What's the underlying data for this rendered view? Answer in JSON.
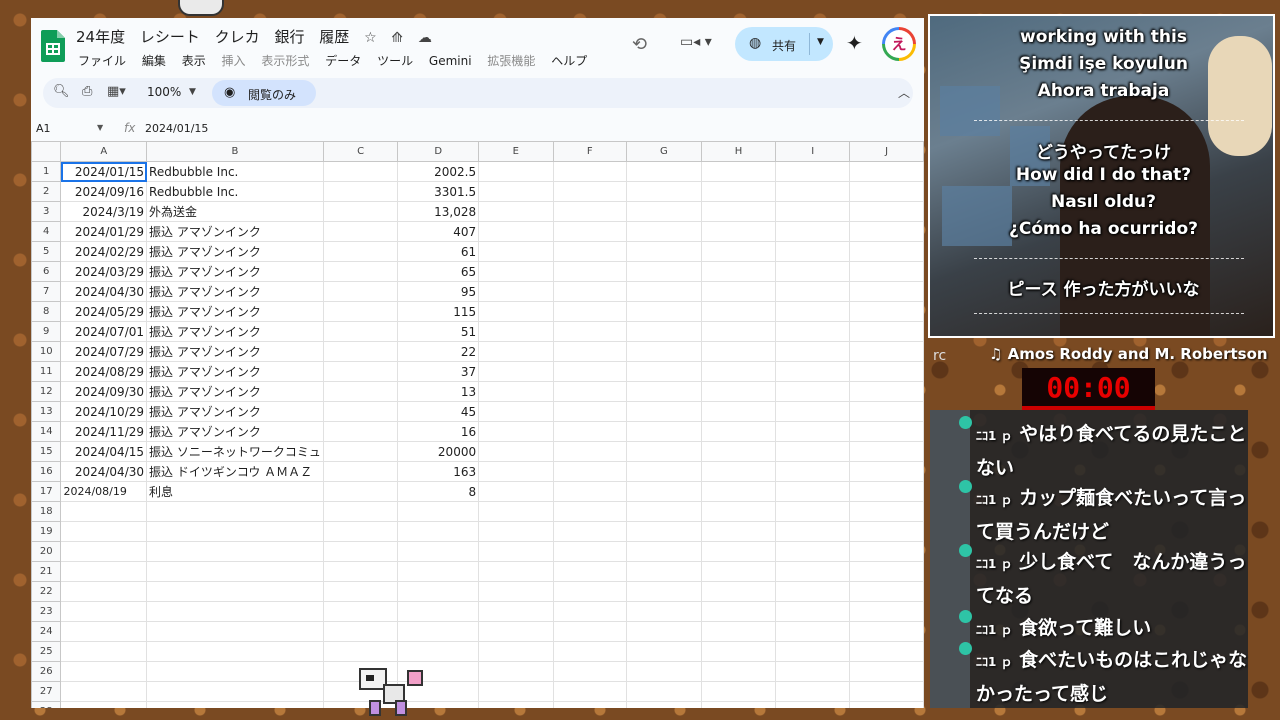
{
  "sheets": {
    "doc_title": "24年度",
    "title_tabs": [
      "レシート",
      "クレカ",
      "銀行",
      "履歴"
    ],
    "menu": [
      {
        "label": "ファイル",
        "enabled": true
      },
      {
        "label": "編集",
        "enabled": true
      },
      {
        "label": "表示",
        "enabled": true
      },
      {
        "label": "挿入",
        "enabled": false
      },
      {
        "label": "表示形式",
        "enabled": false
      },
      {
        "label": "データ",
        "enabled": true
      },
      {
        "label": "ツール",
        "enabled": true
      },
      {
        "label": "Gemini",
        "enabled": true
      },
      {
        "label": "拡張機能",
        "enabled": false
      },
      {
        "label": "ヘルプ",
        "enabled": true
      }
    ],
    "share_label": "共有",
    "avatar_letter": "え",
    "zoom": "100%",
    "view_only_label": "閲覧のみ",
    "name_box": "A1",
    "formula_value": "2024/01/15",
    "columns": [
      "A",
      "B",
      "C",
      "D",
      "E",
      "F",
      "G",
      "H",
      "I",
      "J"
    ],
    "rows": [
      {
        "n": "1",
        "a": "2024/01/15",
        "b": "Redbubble Inc.",
        "d": "2002.5"
      },
      {
        "n": "2",
        "a": "2024/09/16",
        "b": "Redbubble Inc.",
        "d": "3301.5"
      },
      {
        "n": "3",
        "a": "2024/3/19",
        "b": "外為送金",
        "d": "13,028"
      },
      {
        "n": "4",
        "a": "2024/01/29",
        "b": "振込 アマゾンインク",
        "d": "407"
      },
      {
        "n": "5",
        "a": "2024/02/29",
        "b": "振込 アマゾンインク",
        "d": "61"
      },
      {
        "n": "6",
        "a": "2024/03/29",
        "b": "振込 アマゾンインク",
        "d": "65"
      },
      {
        "n": "7",
        "a": "2024/04/30",
        "b": "振込 アマゾンインク",
        "d": "95"
      },
      {
        "n": "8",
        "a": "2024/05/29",
        "b": "振込 アマゾンインク",
        "d": "115"
      },
      {
        "n": "9",
        "a": "2024/07/01",
        "b": "振込 アマゾンインク",
        "d": "51"
      },
      {
        "n": "10",
        "a": "2024/07/29",
        "b": "振込 アマゾンインク",
        "d": "22"
      },
      {
        "n": "11",
        "a": "2024/08/29",
        "b": "振込 アマゾンインク",
        "d": "37"
      },
      {
        "n": "12",
        "a": "2024/09/30",
        "b": "振込 アマゾンインク",
        "d": "13"
      },
      {
        "n": "13",
        "a": "2024/10/29",
        "b": "振込 アマゾンインク",
        "d": "45"
      },
      {
        "n": "14",
        "a": "2024/11/29",
        "b": "振込 アマゾンインク",
        "d": "16"
      },
      {
        "n": "15",
        "a": "2024/04/15",
        "b": "振込 ソニーネットワークコミュ",
        "d": "20000"
      },
      {
        "n": "16",
        "a": "2024/04/30",
        "b": "振込 ドイツギンコウ ＡＭＡＺ",
        "d": "163"
      },
      {
        "n": "17",
        "a": "2024/08/19",
        "b": "利息",
        "d": "8",
        "a_left": true
      },
      {
        "n": "18"
      },
      {
        "n": "19"
      },
      {
        "n": "20"
      },
      {
        "n": "21"
      },
      {
        "n": "22"
      },
      {
        "n": "23"
      },
      {
        "n": "24"
      },
      {
        "n": "25"
      },
      {
        "n": "26"
      },
      {
        "n": "27"
      },
      {
        "n": "28"
      }
    ]
  },
  "stream": {
    "captions": [
      "working with this",
      "Şimdi işe koyulun",
      "Ahora trabaja",
      "どうやってたっけ",
      "How did I do that?",
      "Nasıl oldu?",
      "¿Cómo ha ocurrido?",
      "ピース 作った方がいいな"
    ],
    "rc_label": "rc",
    "music": "♫ Amos Roddy and M. Robertson",
    "timer": "00:00",
    "chat_user": "ﾆｺ1 ｐ",
    "chat": [
      "やはり食べてるの見たことない",
      "カップ麺食べたいって言って買うんだけど",
      "少し食べて　なんか違うってなる",
      "食欲って難しい",
      "食べたいものはこれじゃなかったって感じ"
    ]
  }
}
